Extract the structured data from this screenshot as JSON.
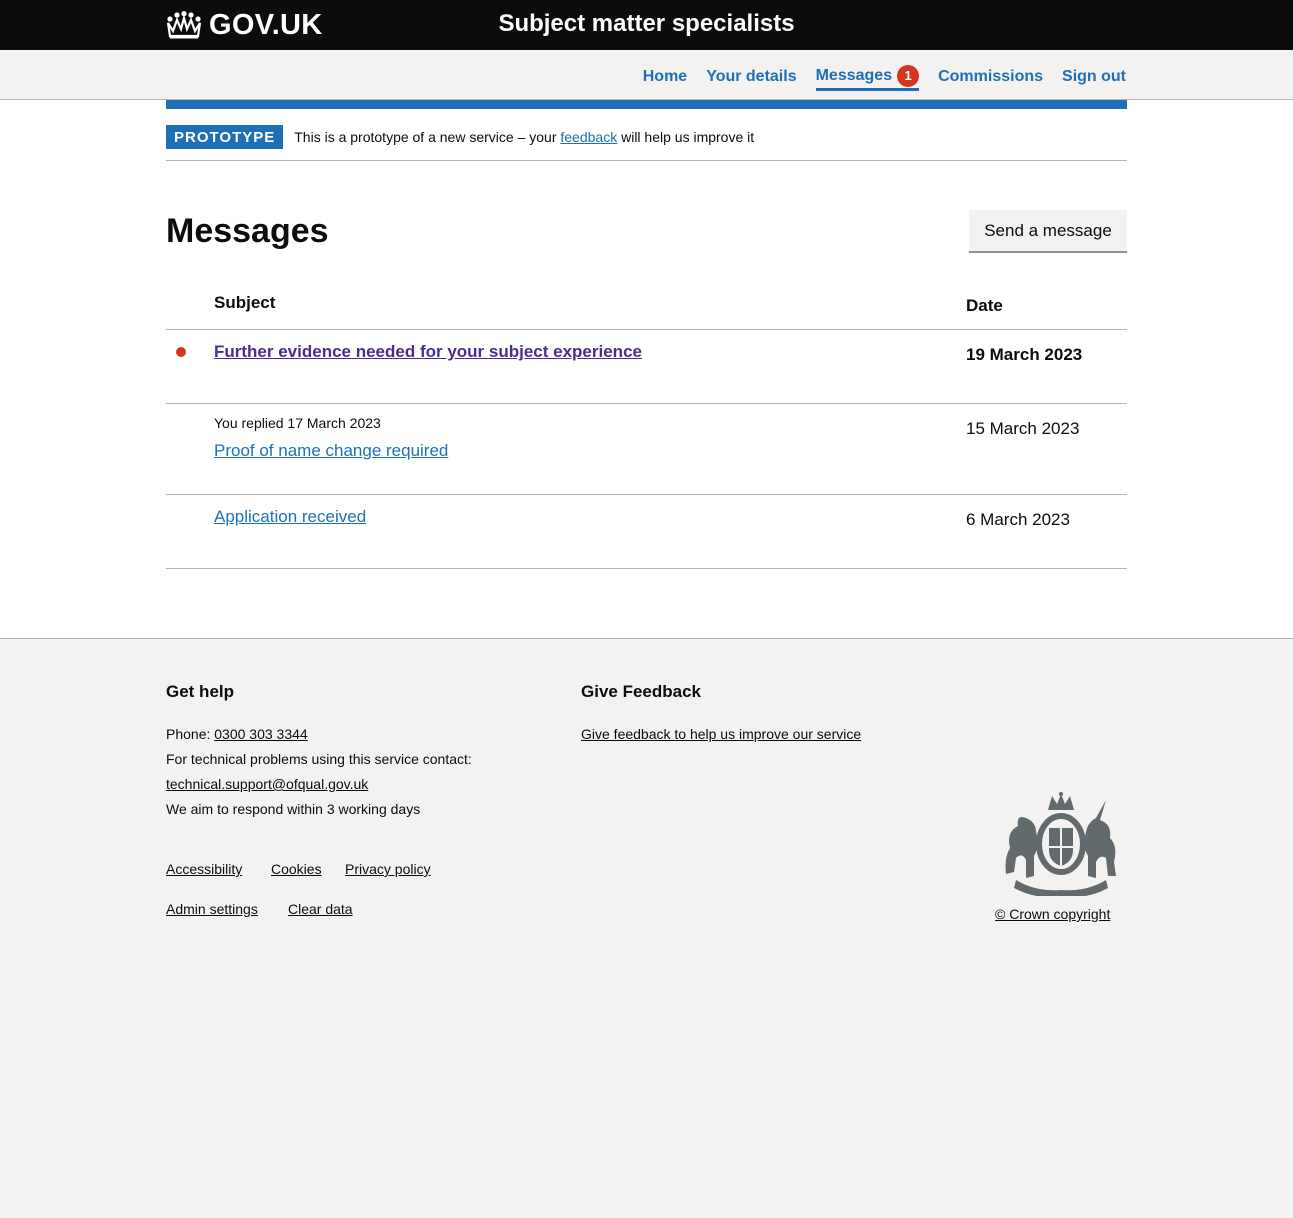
{
  "header": {
    "logo_text": "GOV.UK",
    "service_name": "Subject matter specialists"
  },
  "nav": {
    "items": [
      {
        "label": "Home"
      },
      {
        "label": "Your details"
      },
      {
        "label": "Messages",
        "badge": "1",
        "active": true
      },
      {
        "label": "Commissions"
      },
      {
        "label": "Sign out"
      }
    ]
  },
  "phase_banner": {
    "tag": "PROTOTYPE",
    "text_before": "This is a prototype of a new service – your",
    "link": "feedback",
    "text_after": "will help us improve it"
  },
  "page": {
    "title": "Messages",
    "send_button": "Send a message"
  },
  "table": {
    "headers": {
      "subject": "Subject",
      "date": "Date"
    },
    "rows": [
      {
        "subject": "Further evidence needed for your subject experience",
        "date": "19 March 2023",
        "unread": true,
        "meta": ""
      },
      {
        "subject": "Proof of name change required",
        "date": "15 March 2023",
        "unread": false,
        "meta": "You replied 17 March 2023"
      },
      {
        "subject": "Application received",
        "date": "6 March 2023",
        "unread": false,
        "meta": ""
      }
    ]
  },
  "footer": {
    "help": {
      "heading": "Get help",
      "phone_label": "Phone:",
      "phone": "0300 303 3344",
      "tech_text": "For technical problems using this service contact:",
      "email": "technical.support@ofqual.gov.uk",
      "respond_text": "We aim to respond within 3 working days"
    },
    "feedback": {
      "heading": "Give Feedback",
      "link": "Give feedback to help us improve our service"
    },
    "links_row1": [
      "Accessibility",
      "Cookies",
      "Privacy policy"
    ],
    "links_row2": [
      "Admin settings",
      "Clear data"
    ],
    "copyright": "© Crown copyright"
  },
  "colors": {
    "link": "#1d70b8",
    "visited": "#4c2c92",
    "alert": "#d4351c",
    "header_bg": "#0b0c0c",
    "footer_bg": "#f3f2f1"
  }
}
